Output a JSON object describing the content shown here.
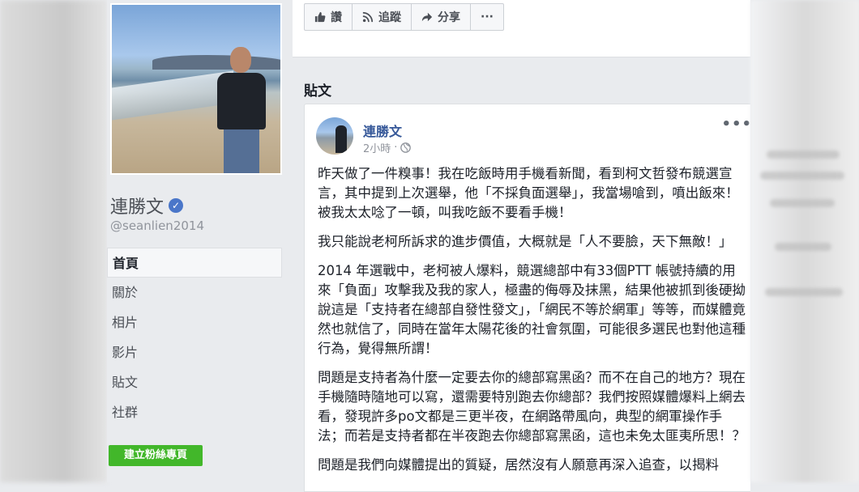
{
  "page": {
    "name": "連勝文",
    "handle": "@seanlien2014",
    "nav": [
      "首頁",
      "關於",
      "相片",
      "影片",
      "貼文",
      "社群"
    ],
    "create_page_label": "建立粉絲專頁"
  },
  "actions": [
    {
      "label": "讚",
      "icon": "thumbs-up-icon"
    },
    {
      "label": "追蹤",
      "icon": "rss-icon"
    },
    {
      "label": "分享",
      "icon": "share-arrow-icon"
    },
    {
      "label": "···",
      "icon": "more-icon"
    }
  ],
  "posts_section_title": "貼文",
  "post": {
    "author": "連勝文",
    "time": "2小時",
    "more_label": "•••",
    "paragraphs": [
      "昨天做了一件糗事！我在吃飯時用手機看新聞，看到柯文哲發布競選宣言，其中提到上次選舉，他「不採負面選舉」，我當場嗆到，噴出飯來！被我太太唸了一頓，叫我吃飯不要看手機！",
      "我只能說老柯所訴求的進步價值，大概就是「人不要臉，天下無敵！」",
      "2014 年選戰中，老柯被人爆料，競選總部中有33個PTT 帳號持續的用來「負面」攻擊我及我的家人，極盡的侮辱及抹黑，結果他被抓到後硬拗說這是「支持者在總部自發性發文」，「網民不等於網軍」等等，而媒體竟然也就信了，同時在當年太陽花後的社會氛圍，可能很多選民也對他這種行為，覺得無所謂！",
      "問題是支持者為什麼一定要去你的總部寫黑函？而不在自己的地方？現在手機隨時隨地可以寫，還需要特別跑去你總部？我們按照媒體爆料上網去看，發現許多po文都是三更半夜，在網路帶風向，典型的網軍操作手法；而若是支持者都在半夜跑去你總部寫黑函，這也未免太匪夷所思！？",
      "問題是我們向媒體提出的質疑，居然沒有人願意再深入追查，以揭料"
    ]
  },
  "colors": {
    "background": "#e9ebee",
    "link": "#365899",
    "create_button": "#42b72a",
    "verified": "#4a76c9"
  }
}
